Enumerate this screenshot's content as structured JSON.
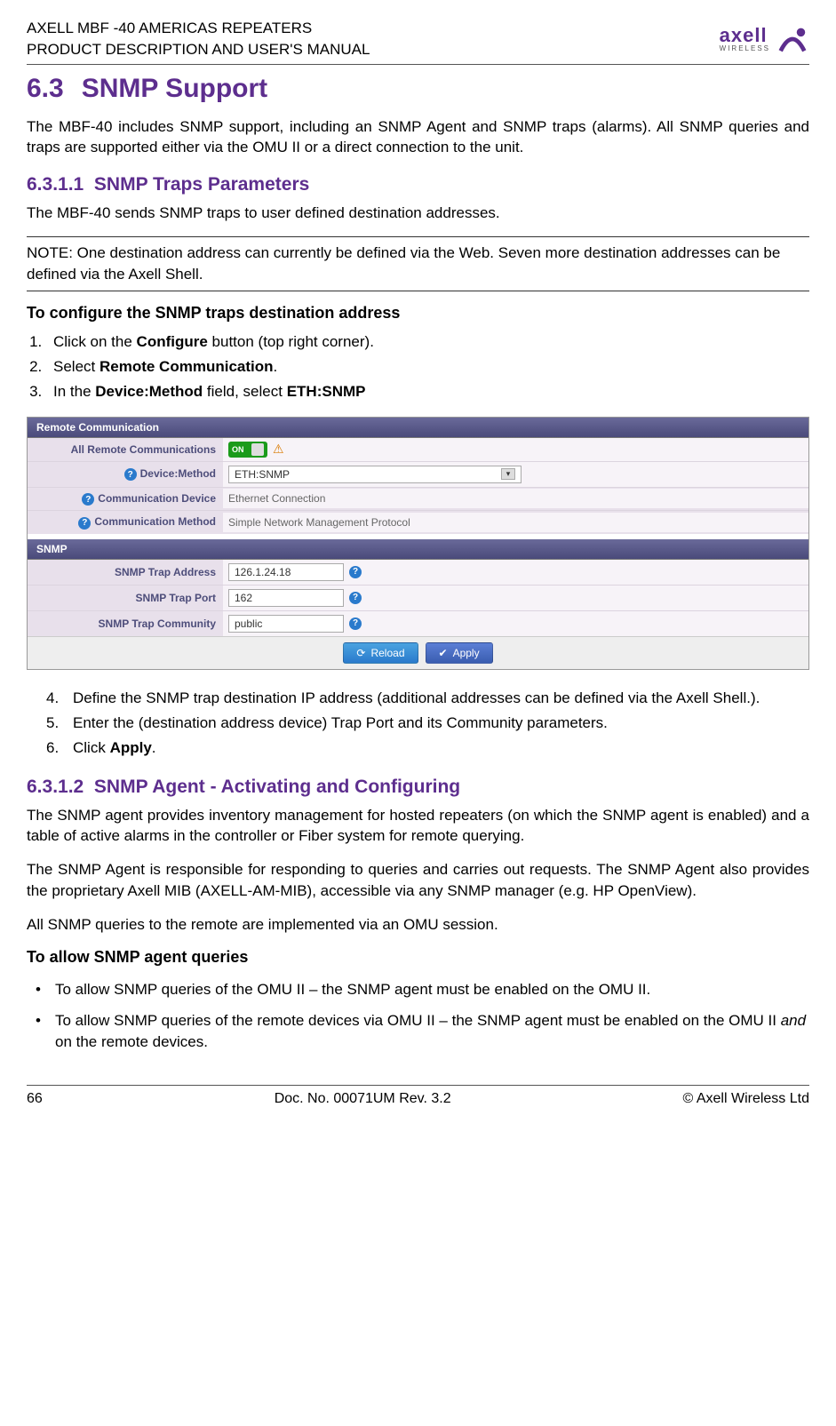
{
  "header": {
    "line1": "AXELL MBF -40 AMERICAS REPEATERS",
    "line2": "PRODUCT DESCRIPTION AND USER'S MANUAL",
    "logo_brand": "axell",
    "logo_sub": "WIRELESS"
  },
  "section": {
    "number": "6.3",
    "title": "SNMP Support",
    "intro": "The MBF-40 includes SNMP support, including an SNMP Agent and SNMP traps (alarms). All SNMP queries and traps are supported either via the OMU II or a direct connection to the unit."
  },
  "sub1": {
    "number": "6.3.1.1",
    "title": "SNMP Traps Parameters",
    "text": "The MBF-40 sends SNMP traps to user defined destination addresses.",
    "note": "NOTE: One destination address can currently be defined via the Web. Seven more destination addresses can be defined via the Axell Shell.",
    "config_head": "To configure the SNMP traps destination address",
    "steps": {
      "s1_a": "Click on the ",
      "s1_b": "Configure",
      "s1_c": " button (top right corner).",
      "s2_a": "Select ",
      "s2_b": "Remote Communication",
      "s2_c": ".",
      "s3_a": "In the ",
      "s3_b": "Device:Method",
      "s3_c": " field, select ",
      "s3_d": "ETH:SNMP",
      "s4": "Define the SNMP trap destination IP address (additional addresses can be defined via the Axell Shell.).",
      "s5": "Enter the (destination address device) Trap Port and its Community parameters.",
      "s6_a": "Click ",
      "s6_b": "Apply",
      "s6_c": "."
    }
  },
  "screenshot": {
    "panel1_title": "Remote Communication",
    "all_remote_label": "All Remote Communications",
    "toggle_text": "ON",
    "device_method_label": "Device:Method",
    "device_method_value": "ETH:SNMP",
    "comm_device_label": "Communication Device",
    "comm_device_value": "Ethernet Connection",
    "comm_method_label": "Communication Method",
    "comm_method_value": "Simple Network Management Protocol",
    "panel2_title": "SNMP",
    "trap_addr_label": "SNMP Trap Address",
    "trap_addr_value": "126.1.24.18",
    "trap_port_label": "SNMP Trap Port",
    "trap_port_value": "162",
    "trap_comm_label": "SNMP Trap Community",
    "trap_comm_value": "public",
    "reload_label": "Reload",
    "apply_label": "Apply"
  },
  "sub2": {
    "number": "6.3.1.2",
    "title": "SNMP Agent - Activating and Configuring",
    "p1": "The SNMP agent provides inventory management for hosted repeaters (on which the SNMP agent is enabled) and a table of active alarms in the controller or Fiber system for remote querying.",
    "p2": "The SNMP Agent is responsible for responding to queries and carries out requests. The SNMP Agent also provides the proprietary Axell MIB (AXELL-AM-MIB), accessible via any SNMP manager (e.g. HP OpenView).",
    "p3": "All SNMP queries to the remote are implemented via an OMU session.",
    "allow_head": "To allow SNMP agent queries",
    "b1": "To allow SNMP queries of the OMU II – the SNMP agent must be enabled on the OMU II.",
    "b2_a": "To allow SNMP queries of the remote devices via OMU II – the SNMP agent must be enabled on the OMU II ",
    "b2_em": "and",
    "b2_b": " on the remote devices."
  },
  "footer": {
    "page": "66",
    "doc": "Doc. No. 00071UM Rev. 3.2",
    "copyright": "© Axell Wireless Ltd"
  }
}
